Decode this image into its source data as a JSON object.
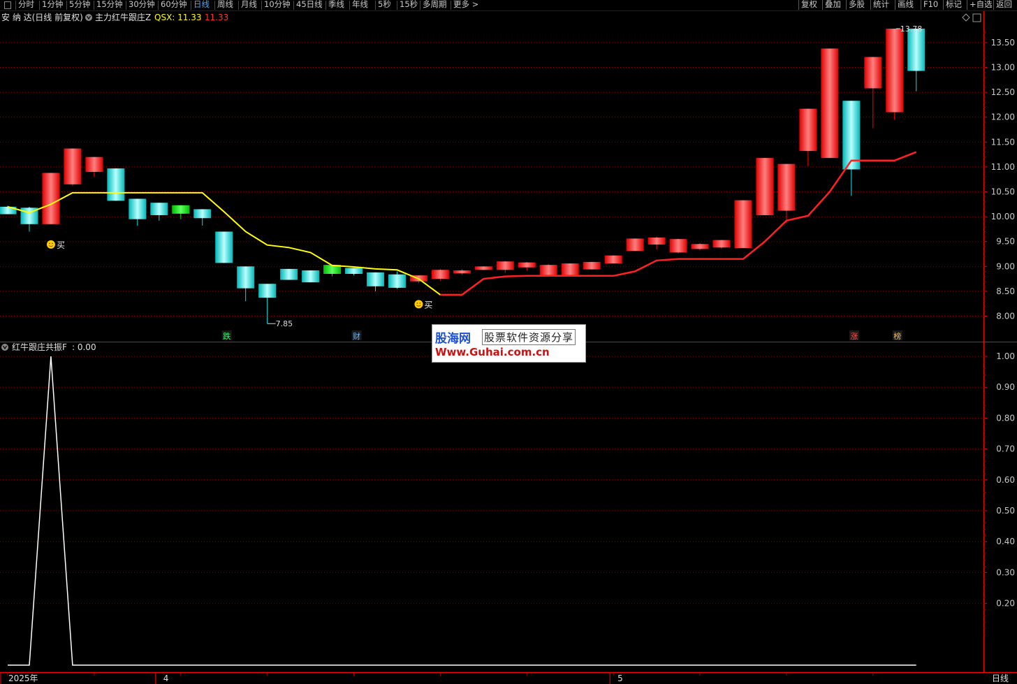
{
  "toolbar": {
    "left_items": [
      "分时",
      "1分钟",
      "5分钟",
      "15分钟",
      "30分钟",
      "60分钟",
      "日线",
      "周线",
      "月线",
      "10分钟",
      "45日线",
      "季线",
      "年线",
      "5秒",
      "15秒",
      "多周期",
      "更多 >"
    ],
    "active": "日线",
    "right_items": [
      "复权",
      "叠加",
      "多股",
      "统计",
      "画线",
      "F10",
      "标记",
      "+自选",
      "返回"
    ]
  },
  "main_panel": {
    "stock_title": "安 纳 达(日线 前复权)",
    "indicator_name": "主力红牛跟庄Z",
    "indicator_var": "QSX: 11.33",
    "indicator_val": ": 11.33",
    "max_label": "13.78",
    "min_label": "7.85",
    "signals": [
      {
        "text": "买",
        "index": 2,
        "price": 9.75
      },
      {
        "text": "买",
        "index": 19,
        "price": 8.55
      }
    ],
    "bottom_markers": [
      {
        "text": "跌",
        "index": 10,
        "color": "#33ff66"
      },
      {
        "text": "财",
        "index": 16,
        "color": "#6ab4ff"
      },
      {
        "text": "涨",
        "index": 39,
        "color": "#ff5050"
      },
      {
        "text": "榜",
        "index": 41,
        "color": "#ffb84a"
      }
    ],
    "y_ticks": [
      "13.50",
      "13.00",
      "12.50",
      "12.00",
      "11.50",
      "11.00",
      "10.50",
      "10.00",
      "9.50",
      "9.00",
      "8.50",
      "8.00"
    ]
  },
  "sub_panel": {
    "indicator_name": "红牛跟庄共振F",
    "indicator_val": ": 0.00",
    "y_ticks": [
      "1.00",
      "0.90",
      "0.80",
      "0.70",
      "0.60",
      "0.50",
      "0.40",
      "0.30",
      "0.20"
    ]
  },
  "x_axis": {
    "labels": [
      {
        "text": "2025年",
        "index": 0
      },
      {
        "text": "4",
        "index": 7
      },
      {
        "text": "5",
        "index": 28
      }
    ],
    "period_label": "日线"
  },
  "watermark": {
    "line1": "股海网",
    "line2": "股票软件资源分享",
    "line3": "Www.Guhai.com.cn"
  },
  "colors": {
    "up_red": "#ff0000",
    "down_cyan": "#00e5e5",
    "down_green": "#00e000",
    "line_yellow": "#ffff00",
    "line_red": "#ff2020",
    "grid": "#8b0000"
  },
  "chart_data": [
    {
      "type": "candlestick",
      "title": "安 纳 达(日线 前复权)",
      "ylim": [
        7.6,
        13.85
      ],
      "series": [
        {
          "name": "K",
          "values": [
            {
              "o": 10.2,
              "h": 10.22,
              "l": 10.05,
              "c": 10.05
            },
            {
              "o": 10.18,
              "h": 10.2,
              "l": 9.7,
              "c": 9.85
            },
            {
              "o": 9.85,
              "h": 10.88,
              "l": 9.85,
              "c": 10.88
            },
            {
              "o": 10.65,
              "h": 11.37,
              "l": 10.62,
              "c": 11.37
            },
            {
              "o": 10.9,
              "h": 11.2,
              "l": 10.8,
              "c": 11.2
            },
            {
              "o": 10.97,
              "h": 10.97,
              "l": 10.32,
              "c": 10.32
            },
            {
              "o": 10.36,
              "h": 10.36,
              "l": 9.82,
              "c": 9.95
            },
            {
              "o": 10.28,
              "h": 10.28,
              "l": 9.92,
              "c": 10.03
            },
            {
              "o": 10.23,
              "h": 10.23,
              "l": 9.95,
              "c": 10.06
            },
            {
              "o": 10.15,
              "h": 10.15,
              "l": 9.82,
              "c": 9.97
            },
            {
              "o": 9.7,
              "h": 9.7,
              "l": 9.07,
              "c": 9.07
            },
            {
              "o": 9.0,
              "h": 9.0,
              "l": 8.3,
              "c": 8.56
            },
            {
              "o": 8.65,
              "h": 8.65,
              "l": 7.85,
              "c": 8.37
            },
            {
              "o": 8.95,
              "h": 8.95,
              "l": 8.73,
              "c": 8.73
            },
            {
              "o": 8.92,
              "h": 8.92,
              "l": 8.68,
              "c": 8.68
            },
            {
              "o": 9.03,
              "h": 9.03,
              "l": 8.8,
              "c": 8.85
            },
            {
              "o": 8.97,
              "h": 8.97,
              "l": 8.82,
              "c": 8.85
            },
            {
              "o": 8.88,
              "h": 8.88,
              "l": 8.5,
              "c": 8.6
            },
            {
              "o": 8.84,
              "h": 8.9,
              "l": 8.55,
              "c": 8.57
            },
            {
              "o": 8.7,
              "h": 8.82,
              "l": 8.66,
              "c": 8.82
            },
            {
              "o": 8.75,
              "h": 8.95,
              "l": 8.72,
              "c": 8.93
            },
            {
              "o": 8.86,
              "h": 8.95,
              "l": 8.83,
              "c": 8.92
            },
            {
              "o": 8.93,
              "h": 9.0,
              "l": 8.93,
              "c": 9.0
            },
            {
              "o": 8.93,
              "h": 9.11,
              "l": 8.87,
              "c": 9.1
            },
            {
              "o": 8.98,
              "h": 9.09,
              "l": 8.92,
              "c": 9.08
            },
            {
              "o": 8.83,
              "h": 9.05,
              "l": 8.8,
              "c": 9.03
            },
            {
              "o": 8.83,
              "h": 9.06,
              "l": 8.83,
              "c": 9.06
            },
            {
              "o": 8.94,
              "h": 9.09,
              "l": 8.94,
              "c": 9.09
            },
            {
              "o": 9.06,
              "h": 9.22,
              "l": 9.06,
              "c": 9.22
            },
            {
              "o": 9.31,
              "h": 9.56,
              "l": 9.31,
              "c": 9.56
            },
            {
              "o": 9.44,
              "h": 9.6,
              "l": 9.34,
              "c": 9.58
            },
            {
              "o": 9.28,
              "h": 9.56,
              "l": 9.26,
              "c": 9.55
            },
            {
              "o": 9.35,
              "h": 9.47,
              "l": 9.32,
              "c": 9.45
            },
            {
              "o": 9.38,
              "h": 9.53,
              "l": 9.35,
              "c": 9.53
            },
            {
              "o": 9.37,
              "h": 10.33,
              "l": 9.37,
              "c": 10.33
            },
            {
              "o": 10.03,
              "h": 11.18,
              "l": 10.03,
              "c": 11.18
            },
            {
              "o": 10.12,
              "h": 11.06,
              "l": 9.87,
              "c": 11.06
            },
            {
              "o": 11.32,
              "h": 12.17,
              "l": 11.02,
              "c": 12.17
            },
            {
              "o": 11.18,
              "h": 13.38,
              "l": 11.18,
              "c": 13.38
            },
            {
              "o": 12.33,
              "h": 12.33,
              "l": 10.42,
              "c": 10.95
            },
            {
              "o": 12.58,
              "h": 13.21,
              "l": 11.78,
              "c": 13.21
            },
            {
              "o": 12.1,
              "h": 13.78,
              "l": 11.95,
              "c": 13.78
            },
            {
              "o": 13.78,
              "h": 13.78,
              "l": 12.52,
              "c": 12.93
            }
          ]
        },
        {
          "name": "QSX",
          "values": [
            10.2,
            10.08,
            10.25,
            10.48,
            10.48,
            10.48,
            10.48,
            10.48,
            10.48,
            10.48,
            10.1,
            9.7,
            9.43,
            9.38,
            9.28,
            9.02,
            8.99,
            8.95,
            8.93,
            8.75,
            8.43,
            8.43,
            8.75,
            8.8,
            8.81,
            8.81,
            8.81,
            8.81,
            8.81,
            8.9,
            9.12,
            9.15,
            9.15,
            9.15,
            9.15,
            9.5,
            9.92,
            10.02,
            10.5,
            11.13,
            11.13,
            11.13,
            11.3,
            11.33
          ],
          "yellow_until": 20
        }
      ]
    },
    {
      "type": "line",
      "title": "红牛跟庄共振F",
      "ylim": [
        0,
        1.0
      ],
      "series": [
        {
          "name": "F",
          "values": [
            0,
            0,
            1,
            0,
            0,
            0,
            0,
            0,
            0,
            0,
            0,
            0,
            0,
            0,
            0,
            0,
            0,
            0,
            0,
            0,
            0,
            0,
            0,
            0,
            0,
            0,
            0,
            0,
            0,
            0,
            0,
            0,
            0,
            0,
            0,
            0,
            0,
            0,
            0,
            0,
            0,
            0,
            0
          ]
        }
      ]
    }
  ]
}
